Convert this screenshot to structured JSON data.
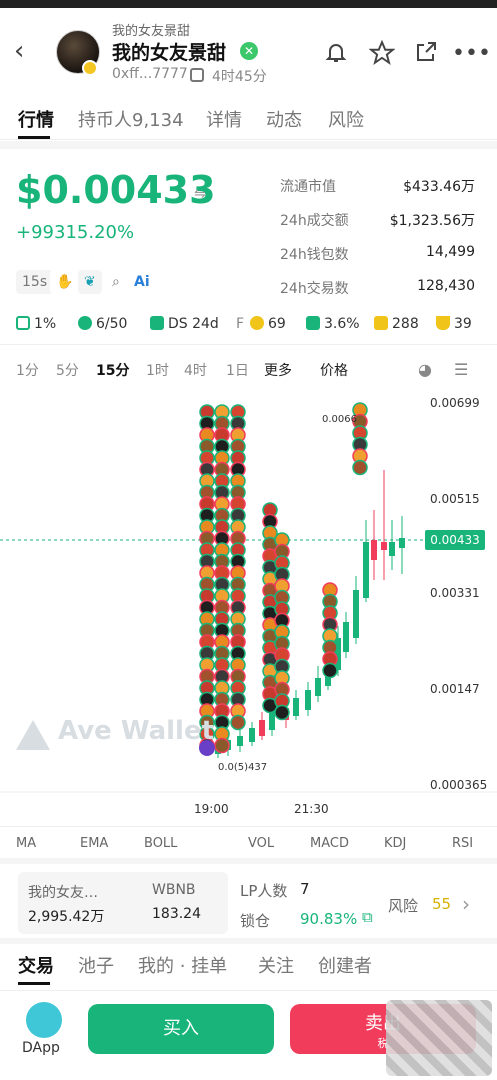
{
  "header": {
    "token_small": "我的女友景甜",
    "token_name": "我的女友景甜",
    "address": "0xff...7777",
    "age": "4时45分"
  },
  "tabs": [
    "行情",
    "持币人9,134",
    "详情",
    "动态",
    "风险"
  ],
  "price": {
    "value": "$0.00433",
    "change": "+99315.20%"
  },
  "stats": [
    {
      "label": "流通市值",
      "value": "$433.46万"
    },
    {
      "label": "24h成交额",
      "value": "$1,323.56万"
    },
    {
      "label": "24h钱包数",
      "value": "14,499"
    },
    {
      "label": "24h交易数",
      "value": "128,430"
    }
  ],
  "chips": [
    "15s",
    "Ai"
  ],
  "badges": [
    {
      "text": "1%",
      "color": "#19b47a"
    },
    {
      "text": "6/50",
      "color": "#19b47a"
    },
    {
      "text": "DS 24d",
      "color": "#19b47a"
    },
    {
      "text": "F",
      "color": "#f0c419"
    },
    {
      "text": "69",
      "color": "#f0c419"
    },
    {
      "text": "3.6%",
      "color": "#19b47a"
    },
    {
      "text": "288",
      "color": "#f0c419"
    },
    {
      "text": "39",
      "color": "#f0c419"
    }
  ],
  "intervals": [
    "1分",
    "5分",
    "15分",
    "1时",
    "4时",
    "1日",
    "更多",
    "价格"
  ],
  "active_interval": "15分",
  "chart_data": {
    "type": "candlestick",
    "y_ticks": [
      "0.00699",
      "0.00515",
      "0.00331",
      "0.00147",
      "0.000365"
    ],
    "current_price_tag": "0.00433",
    "x_ticks": [
      "19:00",
      "21:30"
    ],
    "low_label": "0.0(5)437",
    "high_label": "0.0066",
    "watermark": "Ave Wallet"
  },
  "indicators": [
    "MA",
    "EMA",
    "BOLL",
    "VOL",
    "MACD",
    "KDJ",
    "RSI"
  ],
  "pool": {
    "token_label": "我的女友…",
    "token_value": "2,995.42万",
    "quote_label": "WBNB",
    "quote_value": "183.24"
  },
  "lp": {
    "count_label": "LP人数",
    "count_value": "7",
    "lock_label": "锁仓",
    "lock_value": "90.83%",
    "risk_label": "风险",
    "risk_value": "55"
  },
  "bottom_tabs": [
    "交易",
    "池子",
    "我的 · 挂单",
    "关注",
    "创建者"
  ],
  "footer": {
    "dapp": "DApp",
    "buy": "买入",
    "sell": "卖出",
    "sell_sub": "税"
  }
}
